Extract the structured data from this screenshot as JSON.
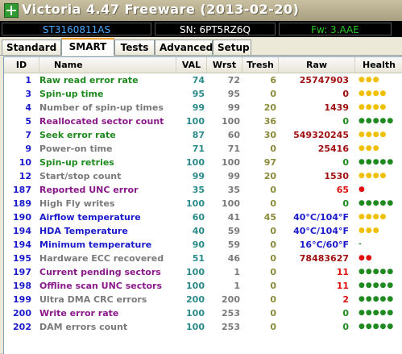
{
  "window": {
    "title": "Victoria 4.47  Freeware (2013-02-20)"
  },
  "drive": {
    "model": "ST3160811AS",
    "serial": "SN: 6PT5RZ6Q",
    "firmware": "Fw: 3.AAE"
  },
  "tabs": [
    {
      "label": "Standard"
    },
    {
      "label": "SMART"
    },
    {
      "label": "Tests"
    },
    {
      "label": "Advanced"
    },
    {
      "label": "Setup"
    }
  ],
  "active_tab": "SMART",
  "table": {
    "headers": {
      "id": "ID",
      "name": "Name",
      "val": "VAL",
      "wrst": "Wrst",
      "tresh": "Tresh",
      "raw": "Raw",
      "health": "Health"
    },
    "rows": [
      {
        "id": "1",
        "name": "Raw read error rate",
        "val": "74",
        "wrst": "72",
        "tresh": "6",
        "raw": "25747903",
        "health": "●●●",
        "name_color": "#1f8a1f",
        "raw_color": "#a01010",
        "health_color": "#f0c000"
      },
      {
        "id": "3",
        "name": "Spin-up time",
        "val": "95",
        "wrst": "95",
        "tresh": "0",
        "raw": "0",
        "health": "●●●●",
        "name_color": "#1f8a1f",
        "raw_color": "#a01010",
        "health_color": "#f0c000"
      },
      {
        "id": "4",
        "name": "Number of spin-up times",
        "val": "99",
        "wrst": "99",
        "tresh": "20",
        "raw": "1439",
        "health": "●●●●",
        "name_color": "#7a7a7a",
        "raw_color": "#a01010",
        "health_color": "#f0c000"
      },
      {
        "id": "5",
        "name": "Reallocated sector count",
        "val": "100",
        "wrst": "100",
        "tresh": "36",
        "raw": "0",
        "health": "●●●●●",
        "name_color": "#8a1a8a",
        "raw_color": "#1f8a1f",
        "health_color": "#1f8a1f"
      },
      {
        "id": "7",
        "name": "Seek error rate",
        "val": "87",
        "wrst": "60",
        "tresh": "30",
        "raw": "549320245",
        "health": "●●●●",
        "name_color": "#1f8a1f",
        "raw_color": "#a01010",
        "health_color": "#f0c000"
      },
      {
        "id": "9",
        "name": "Power-on time",
        "val": "71",
        "wrst": "71",
        "tresh": "0",
        "raw": "25416",
        "health": "●●●",
        "name_color": "#7a7a7a",
        "raw_color": "#a01010",
        "health_color": "#f0c000"
      },
      {
        "id": "10",
        "name": "Spin-up retries",
        "val": "100",
        "wrst": "100",
        "tresh": "97",
        "raw": "0",
        "health": "●●●●●",
        "name_color": "#1f8a1f",
        "raw_color": "#1f8a1f",
        "health_color": "#1f8a1f"
      },
      {
        "id": "12",
        "name": "Start/stop count",
        "val": "99",
        "wrst": "99",
        "tresh": "20",
        "raw": "1530",
        "health": "●●●●",
        "name_color": "#7a7a7a",
        "raw_color": "#a01010",
        "health_color": "#f0c000"
      },
      {
        "id": "187",
        "name": "Reported UNC error",
        "val": "35",
        "wrst": "35",
        "tresh": "0",
        "raw": "65",
        "health": "●",
        "name_color": "#8a1a8a",
        "raw_color": "#e01010",
        "health_color": "#e01010"
      },
      {
        "id": "189",
        "name": "High Fly writes",
        "val": "100",
        "wrst": "100",
        "tresh": "0",
        "raw": "0",
        "health": "●●●●●",
        "name_color": "#7a7a7a",
        "raw_color": "#1f8a1f",
        "health_color": "#1f8a1f"
      },
      {
        "id": "190",
        "name": "Airflow temperature",
        "val": "60",
        "wrst": "41",
        "tresh": "45",
        "raw": "40°C/104°F",
        "health": "●●●●",
        "name_color": "#1a1acc",
        "raw_color": "#1a1acc",
        "health_color": "#f0c000"
      },
      {
        "id": "194",
        "name": "HDA Temperature",
        "val": "40",
        "wrst": "59",
        "tresh": "0",
        "raw": "40°C/104°F",
        "health": "●●●",
        "name_color": "#1a1acc",
        "raw_color": "#1a1acc",
        "health_color": "#f0c000"
      },
      {
        "id": "194",
        "name": "Minimum temperature",
        "val": "90",
        "wrst": "59",
        "tresh": "0",
        "raw": "16°C/60°F",
        "health": "-",
        "name_color": "#1a1acc",
        "raw_color": "#1a1acc",
        "health_color": "#1f8a1f"
      },
      {
        "id": "195",
        "name": "Hardware ECC recovered",
        "val": "51",
        "wrst": "46",
        "tresh": "0",
        "raw": "78483627",
        "health": "●●",
        "name_color": "#7a7a7a",
        "raw_color": "#a01010",
        "health_color": "#e01010"
      },
      {
        "id": "197",
        "name": "Current pending sectors",
        "val": "100",
        "wrst": "1",
        "tresh": "0",
        "raw": "11",
        "health": "●●●●●",
        "name_color": "#8a1a8a",
        "raw_color": "#e01010",
        "health_color": "#1f8a1f"
      },
      {
        "id": "198",
        "name": "Offline scan UNC sectors",
        "val": "100",
        "wrst": "1",
        "tresh": "0",
        "raw": "11",
        "health": "●●●●●",
        "name_color": "#8a1a8a",
        "raw_color": "#e01010",
        "health_color": "#1f8a1f"
      },
      {
        "id": "199",
        "name": "Ultra DMA CRC errors",
        "val": "200",
        "wrst": "200",
        "tresh": "0",
        "raw": "2",
        "health": "●●●●●",
        "name_color": "#7a7a7a",
        "raw_color": "#e01010",
        "health_color": "#1f8a1f"
      },
      {
        "id": "200",
        "name": "Write error rate",
        "val": "100",
        "wrst": "253",
        "tresh": "0",
        "raw": "0",
        "health": "●●●●●",
        "name_color": "#8a1a8a",
        "raw_color": "#1f8a1f",
        "health_color": "#1f8a1f"
      },
      {
        "id": "202",
        "name": "DAM errors count",
        "val": "100",
        "wrst": "253",
        "tresh": "0",
        "raw": "0",
        "health": "●●●●●",
        "name_color": "#7a7a7a",
        "raw_color": "#1f8a1f",
        "health_color": "#1f8a1f"
      }
    ]
  }
}
